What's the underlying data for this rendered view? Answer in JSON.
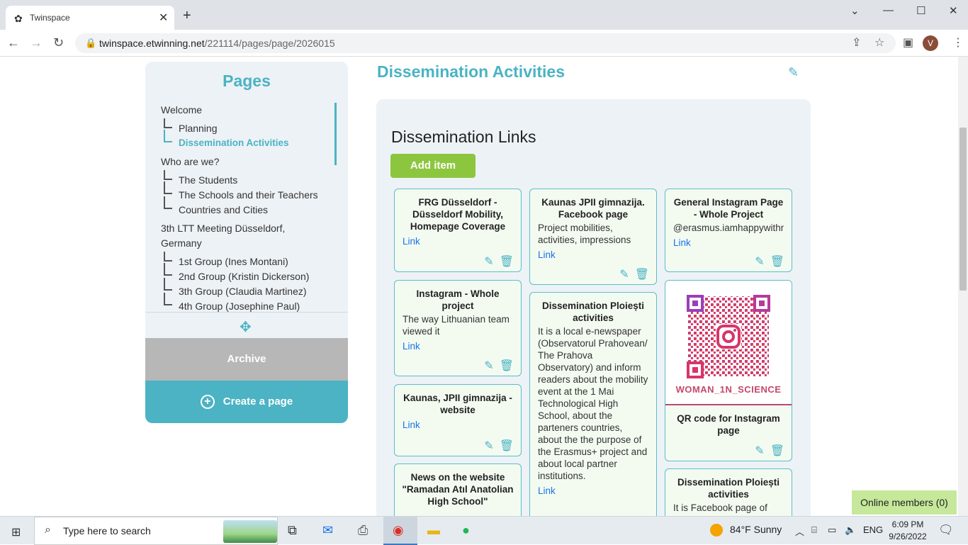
{
  "browser": {
    "tab_title": "Twinspace",
    "tab_icon": "twinspace-favicon",
    "url_host": "twinspace.etwinning.net",
    "url_path": "/221114/pages/page/2026015"
  },
  "sidebar": {
    "title": "Pages",
    "tree": [
      {
        "label": "Welcome",
        "level": 0
      },
      {
        "label": "Planning",
        "level": 1
      },
      {
        "label": "Dissemination Activities",
        "level": 1,
        "active": true
      },
      {
        "label": "Who are we?",
        "level": 0
      },
      {
        "label": "The Students",
        "level": 1
      },
      {
        "label": "The Schools and their Teachers",
        "level": 1
      },
      {
        "label": "Countries and Cities",
        "level": 1
      },
      {
        "label": "3th LTT Meeting Düsseldorf,",
        "level": 0
      },
      {
        "label": "Germany",
        "level": 0
      },
      {
        "label": "1st Group (Ines Montani)",
        "level": 1
      },
      {
        "label": "2nd Group (Kristin Dickerson)",
        "level": 1
      },
      {
        "label": "3th Group (Claudia Martinez)",
        "level": 1
      },
      {
        "label": "4th Group (Josephine Paul)",
        "level": 1
      }
    ],
    "archive_label": "Archive",
    "create_label": "Create a page"
  },
  "main": {
    "page_title": "Dissemination Activities",
    "section_title": "Dissemination Links",
    "add_item_label": "Add item",
    "link_label": "Link",
    "cards": [
      {
        "title": "FRG Düsseldorf - Düsseldorf Mobility, Homepage Coverage",
        "desc": ""
      },
      {
        "title": "Kaunas JPII gimnazija. Facebook page",
        "desc": "Project mobilities, activities, impressions"
      },
      {
        "title": "General Instagram Page - Whole Project",
        "desc": "@erasmus.iamhappywithn"
      },
      {
        "title": "Instagram - Whole project",
        "desc": "The way Lithuanian team viewed it"
      },
      {
        "title": "Dissemination Ploiești activities",
        "desc": "It is a local e-newspaper (Observatorul Prahovean/ The Prahova Observatory) and inform readers about the mobility event at the 1 Mai Technological High School, about the parteners countries, about the the purpose of the Erasmus+ project and about local partner institutions."
      },
      {
        "title": "QR code for Instagram page",
        "desc": "",
        "image_label": "WOMAN_1N_SCIENCE"
      },
      {
        "title": "Kaunas, JPII gimnazija - website",
        "desc": ""
      },
      {
        "title": "News on the website \"Ramadan Atıl Anatolian High School\"",
        "desc": ""
      },
      {
        "title": "Dissemination Ploiești activities",
        "desc": "It is Facebook page of"
      }
    ],
    "online_members": "Online members (0)"
  },
  "taskbar": {
    "search_placeholder": "Type here to search",
    "weather": "84°F  Sunny",
    "language": "ENG",
    "time": "6:09 PM",
    "date": "9/26/2022"
  },
  "colors": {
    "accent": "#4bb3c3",
    "add_button": "#8cc63f",
    "card_bg": "#f3fbf1",
    "online_bg": "#c5e89a"
  }
}
